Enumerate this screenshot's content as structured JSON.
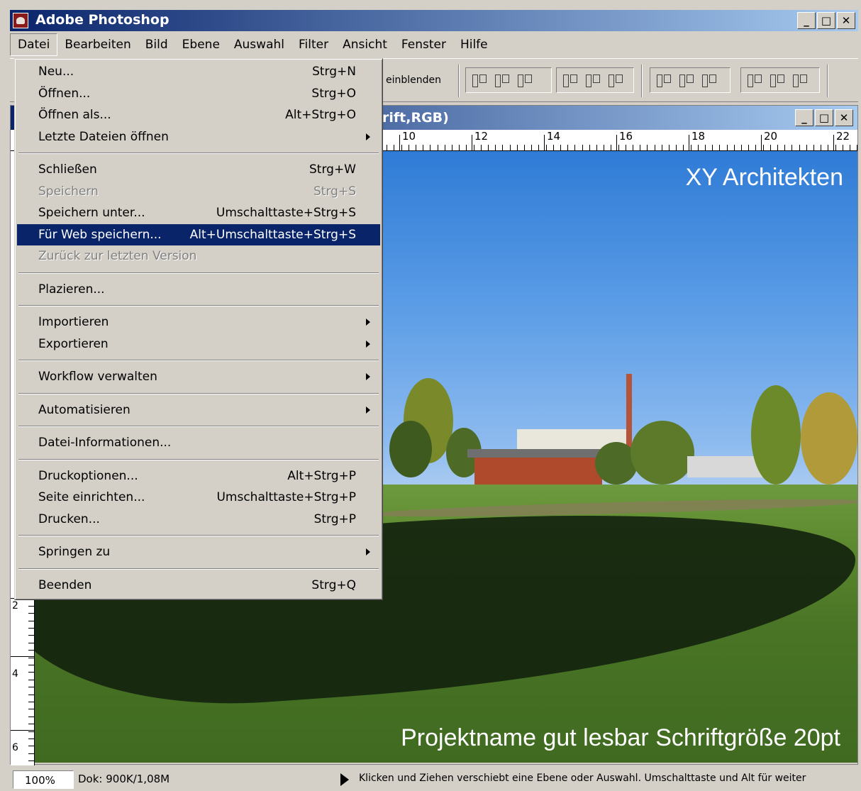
{
  "app": {
    "title": "Adobe Photoshop"
  },
  "window_buttons": {
    "minimize": "_",
    "maximize": "□",
    "close": "✕"
  },
  "menubar": [
    "Datei",
    "Bearbeiten",
    "Bild",
    "Ebene",
    "Auswahl",
    "Filter",
    "Ansicht",
    "Fenster",
    "Hilfe"
  ],
  "optionbar": {
    "label": "einblenden"
  },
  "document": {
    "title": "rift,RGB)",
    "hruler_labels": [
      "10",
      "12",
      "14",
      "16",
      "18",
      "20",
      "22"
    ],
    "vruler_labels": [
      "2",
      "4",
      "6"
    ],
    "image_title": "XY Architekten",
    "image_caption": "Projektname gut lesbar Schriftgröße 20pt"
  },
  "statusbar": {
    "zoom": "100%",
    "doc_info": "Dok: 900K/1,08M",
    "message": "Klicken und Ziehen verschiebt eine Ebene oder Auswahl.  Umschalttaste und Alt für weiter"
  },
  "file_menu": {
    "groups": [
      [
        {
          "label": "Neu...",
          "shortcut": "Strg+N"
        },
        {
          "label": "Öffnen...",
          "shortcut": "Strg+O"
        },
        {
          "label": "Öffnen als...",
          "shortcut": "Alt+Strg+O"
        },
        {
          "label": "Letzte Dateien öffnen",
          "submenu": true
        }
      ],
      [
        {
          "label": "Schließen",
          "shortcut": "Strg+W"
        },
        {
          "label": "Speichern",
          "shortcut": "Strg+S",
          "disabled": true
        },
        {
          "label": "Speichern unter...",
          "shortcut": "Umschalttaste+Strg+S"
        },
        {
          "label": "Für Web speichern...",
          "shortcut": "Alt+Umschalttaste+Strg+S",
          "highlighted": true
        },
        {
          "label": "Zurück zur letzten Version",
          "disabled": true
        }
      ],
      [
        {
          "label": "Plazieren..."
        }
      ],
      [
        {
          "label": "Importieren",
          "submenu": true
        },
        {
          "label": "Exportieren",
          "submenu": true
        }
      ],
      [
        {
          "label": "Workflow verwalten",
          "submenu": true
        }
      ],
      [
        {
          "label": "Automatisieren",
          "submenu": true
        }
      ],
      [
        {
          "label": "Datei-Informationen..."
        }
      ],
      [
        {
          "label": "Druckoptionen...",
          "shortcut": "Alt+Strg+P"
        },
        {
          "label": "Seite einrichten...",
          "shortcut": "Umschalttaste+Strg+P"
        },
        {
          "label": "Drucken...",
          "shortcut": "Strg+P"
        }
      ],
      [
        {
          "label": "Springen zu",
          "submenu": true
        }
      ],
      [
        {
          "label": "Beenden",
          "shortcut": "Strg+Q"
        }
      ]
    ]
  }
}
